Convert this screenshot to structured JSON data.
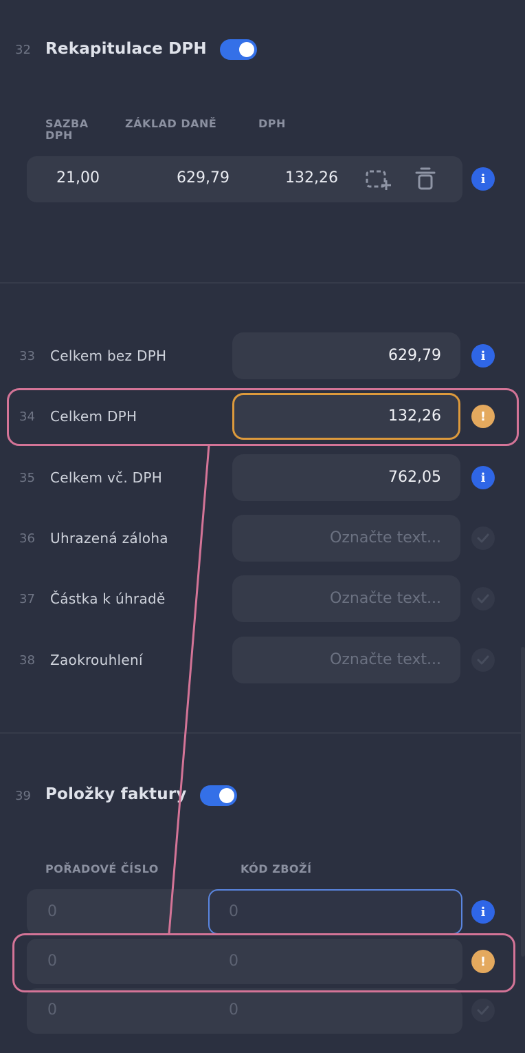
{
  "vat_summary": {
    "number": "32",
    "title": "Rekapitulace DPH",
    "enabled": true,
    "columns": [
      "SAZBA DPH",
      "ZÁKLAD DANĚ",
      "DPH"
    ],
    "rows": [
      {
        "rate": "21,00",
        "base": "629,79",
        "vat": "132,26"
      }
    ]
  },
  "totals": [
    {
      "number": "33",
      "label": "Celkem bez DPH",
      "value": "629,79",
      "status": "info"
    },
    {
      "number": "34",
      "label": "Celkem DPH",
      "value": "132,26",
      "status": "warning"
    },
    {
      "number": "35",
      "label": "Celkem vč. DPH",
      "value": "762,05",
      "status": "info"
    },
    {
      "number": "36",
      "label": "Uhrazená záloha",
      "placeholder": "Označte text...",
      "status": "ok"
    },
    {
      "number": "37",
      "label": "Částka k úhradě",
      "placeholder": "Označte text...",
      "status": "ok"
    },
    {
      "number": "38",
      "label": "Zaokrouhlení",
      "placeholder": "Označte text...",
      "status": "ok"
    }
  ],
  "invoice_items": {
    "number": "39",
    "title": "Položky faktury",
    "enabled": true,
    "columns": [
      "POŘADOVÉ ČÍSLO",
      "KÓD ZBOŽÍ"
    ],
    "rows": [
      {
        "order": "0",
        "code": "0",
        "status": "info"
      },
      {
        "order": "0",
        "code": "0",
        "status": "warning"
      },
      {
        "order": "0",
        "code": "0",
        "status": "ok"
      }
    ]
  },
  "colors": {
    "background": "#2b3040",
    "field": "#363b4a",
    "accent_blue": "#2f66e6",
    "warning_orange": "#e4a95e",
    "highlight_pink": "#d47497"
  }
}
